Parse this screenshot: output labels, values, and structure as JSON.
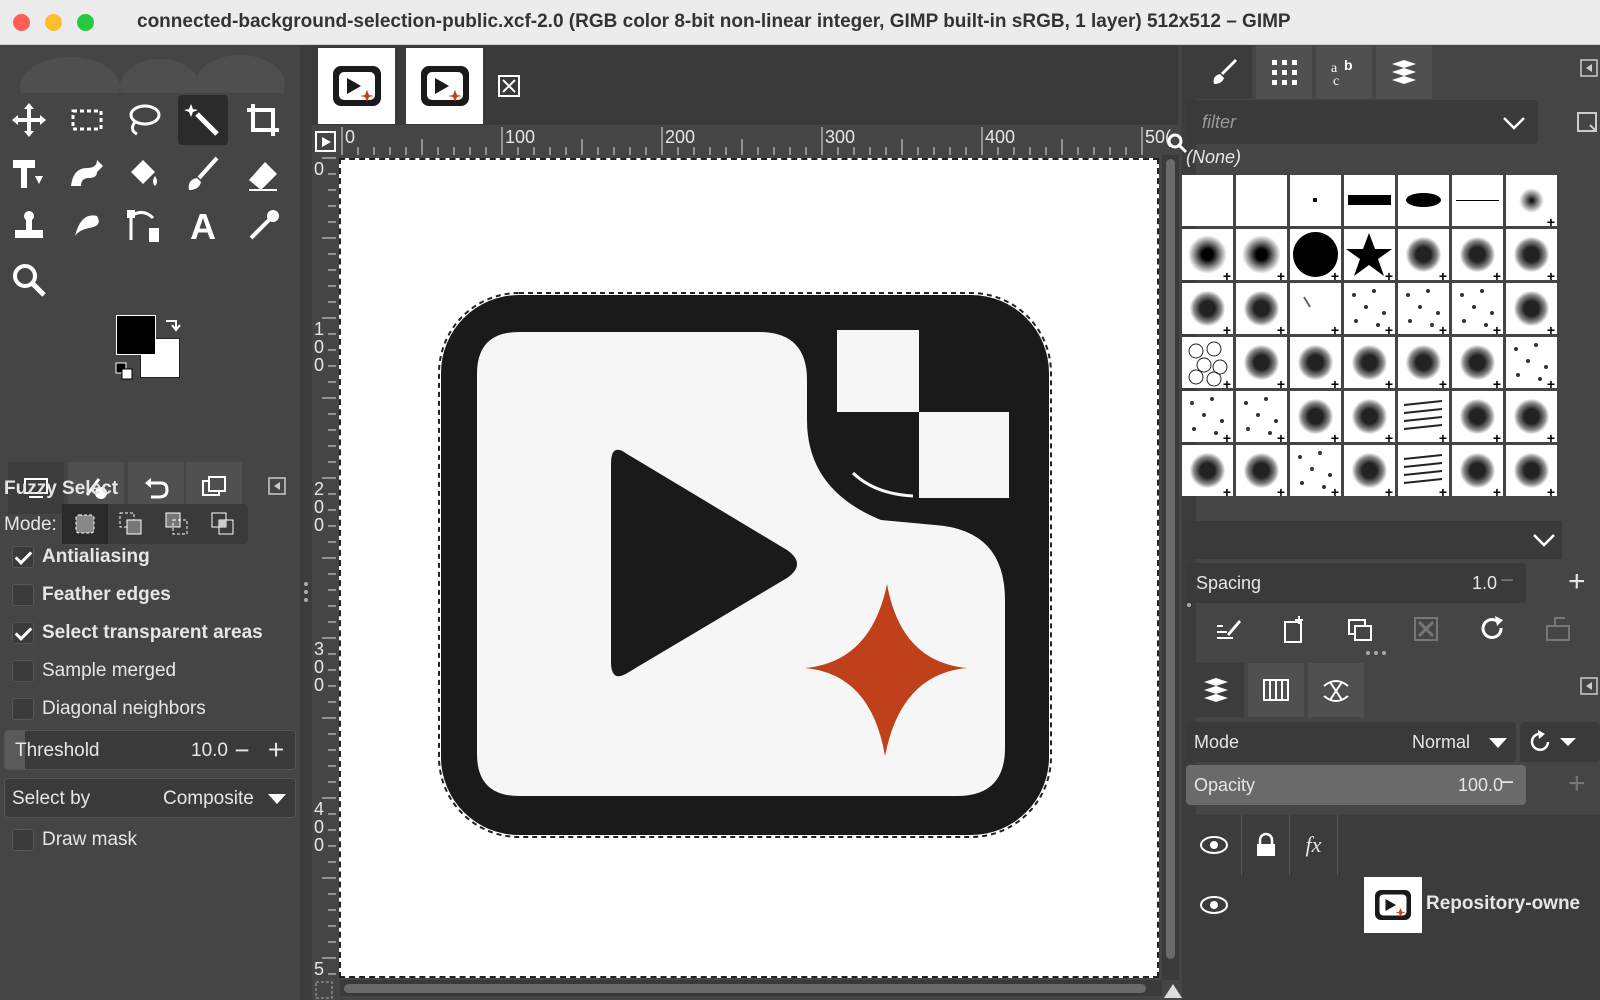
{
  "window": {
    "title": "connected-background-selection-public.xcf-2.0 (RGB color 8-bit non-linear integer, GIMP built-in sRGB, 1 layer) 512x512 – GIMP"
  },
  "tool_options": {
    "title": "Fuzzy Select",
    "mode_label": "Mode:",
    "options": [
      {
        "label": "Antialiasing",
        "checked": true
      },
      {
        "label": "Feather edges",
        "checked": false
      },
      {
        "label": "Select transparent areas",
        "checked": true
      },
      {
        "label": "Sample merged",
        "checked": false
      },
      {
        "label": "Diagonal neighbors",
        "checked": false
      }
    ],
    "threshold_label": "Threshold",
    "threshold_value": "10.0",
    "select_by_label": "Select by",
    "select_by_value": "Composite",
    "draw_mask_label": "Draw mask",
    "draw_mask_checked": false
  },
  "rulers": {
    "horizontal": [
      "0",
      "100",
      "200",
      "300",
      "400",
      "50("
    ],
    "vertical": [
      [
        "0"
      ],
      [
        "1",
        "0",
        "0"
      ],
      [
        "2",
        "0",
        "0"
      ],
      [
        "3",
        "0",
        "0"
      ],
      [
        "4",
        "0",
        "0"
      ],
      [
        "5"
      ]
    ]
  },
  "brushes": {
    "filter_placeholder": "filter",
    "selected_name": "(None)",
    "spacing_label": "Spacing",
    "spacing_value": "1.0"
  },
  "layers": {
    "mode_label": "Mode",
    "mode_value": "Normal",
    "opacity_label": "Opacity",
    "opacity_value": "100.0",
    "layer_name": "Repository-owne"
  },
  "colors": {
    "accent_star": "#c0401c",
    "logo_dark": "#1a1a1a",
    "foreground": "#000000",
    "background": "#ffffff"
  }
}
